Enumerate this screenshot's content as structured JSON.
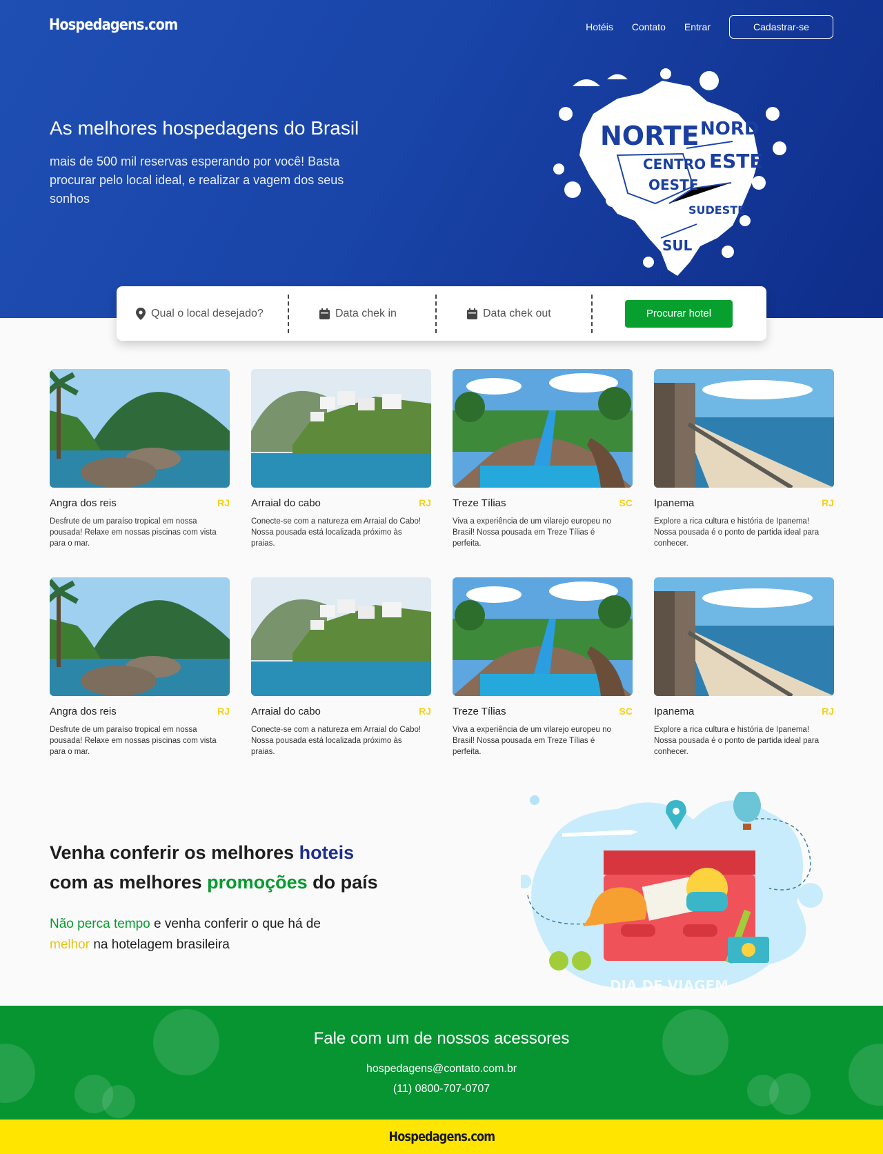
{
  "header": {
    "logo": "Hospedagens.com",
    "nav": [
      "Hotéis",
      "Contato",
      "Entrar"
    ],
    "signup": "Cadastrar-se"
  },
  "hero": {
    "title": "As melhores hospedagens do Brasil",
    "subtitle": "mais de 500 mil reservas esperando por você! Basta procurar pelo local ideal, e realizar a vagem dos seus sonhos",
    "map_labels": [
      "NORTE",
      "NORD",
      "ESTE",
      "CENTRO",
      "OESTE",
      "SUDESTE",
      "SUL"
    ]
  },
  "search": {
    "location": "Qual o local desejado?",
    "checkin": "Data chek in",
    "checkout": "Data chek out",
    "button": "Procurar hotel",
    "icons": [
      "map-pin-icon",
      "calendar-icon",
      "calendar-icon"
    ]
  },
  "cards": [
    {
      "name": "Angra dos reis",
      "uf": "RJ",
      "desc": "Desfrute de um paraíso tropical em nossa pousada! Relaxe em nossas piscinas com vista para o mar.",
      "scene": "angra"
    },
    {
      "name": "Arraial do cabo",
      "uf": "RJ",
      "desc": "Conecte-se com a natureza em Arraial do Cabo! Nossa pousada está localizada próximo às praias.",
      "scene": "arraial"
    },
    {
      "name": "Treze Tílias",
      "uf": "SC",
      "desc": "Viva a experiência de um vilarejo europeu no Brasil! Nossa pousada em Treze Tílias é perfeita.",
      "scene": "treze"
    },
    {
      "name": "Ipanema",
      "uf": "RJ",
      "desc": "Explore a rica cultura e história de Ipanema! Nossa pousada é o ponto de partida ideal para conhecer.",
      "scene": "ipanema"
    },
    {
      "name": "Angra dos reis",
      "uf": "RJ",
      "desc": "Desfrute de um paraíso tropical em nossa pousada! Relaxe em nossas piscinas com vista para o mar.",
      "scene": "angra"
    },
    {
      "name": "Arraial do cabo",
      "uf": "RJ",
      "desc": "Conecte-se com a natureza em Arraial do Cabo! Nossa pousada está localizada próximo às praias.",
      "scene": "arraial"
    },
    {
      "name": "Treze Tílias",
      "uf": "SC",
      "desc": "Viva a experiência de um vilarejo europeu no Brasil! Nossa pousada em Treze Tílias é perfeita.",
      "scene": "treze"
    },
    {
      "name": "Ipanema",
      "uf": "RJ",
      "desc": "Explore a rica cultura e história de Ipanema! Nossa pousada é o ponto de partida ideal para conhecer.",
      "scene": "ipanema"
    }
  ],
  "promo": {
    "line1_a": "Venha conferir os melhores ",
    "line1_b": "hoteis",
    "line2_a": "com as melhores ",
    "line2_b": "promoções",
    "line2_c": " do país",
    "sub1_a": "Não perca tempo",
    "sub1_b": " e venha conferir o que há de",
    "sub2_a": "melhor",
    "sub2_b": " na hotelagem brasileira",
    "illustration_caption": "DIA DE VIAGEM"
  },
  "footer": {
    "title": "Fale com um de nossos acessores",
    "email": "hospedagens@contato.com.br",
    "phone": "(11) 0800-707-0707",
    "logo": "Hospedagens.com"
  },
  "colors": {
    "hero_blue": "#1a46aa",
    "green": "#07a02f",
    "yellow": "#ffe500",
    "promo_blue": "#1c2f8f"
  }
}
